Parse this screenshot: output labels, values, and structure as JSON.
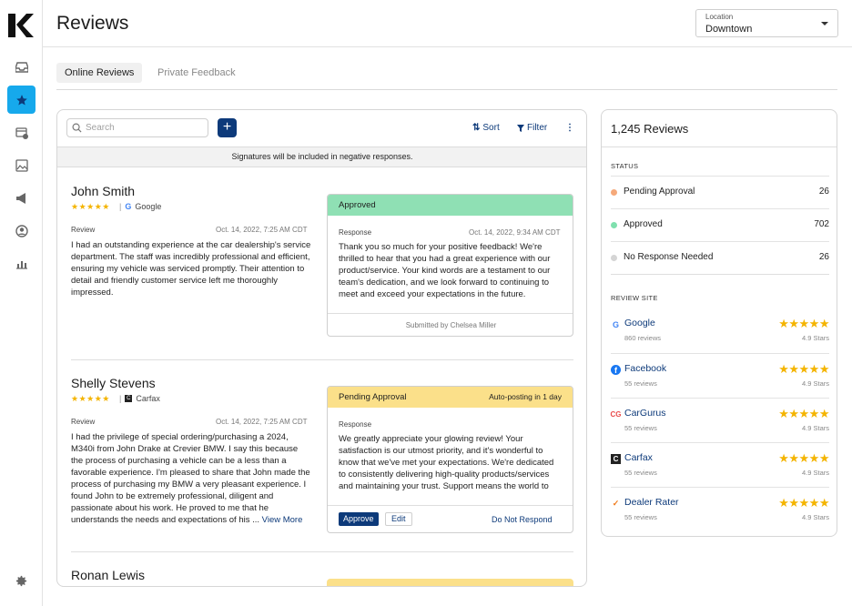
{
  "page": {
    "title": "Reviews"
  },
  "location": {
    "label": "Location",
    "value": "Downtown"
  },
  "tabs": [
    {
      "label": "Online Reviews"
    },
    {
      "label": "Private Feedback"
    }
  ],
  "toolbar": {
    "search_placeholder": "Search",
    "add_label": "+",
    "sort_label": "Sort",
    "filter_label": "Filter",
    "more_label": "⋮"
  },
  "banner": "Signatures will be included in negative responses.",
  "reviews": [
    {
      "name": "John Smith",
      "stars": "★★★★★",
      "site": "Google",
      "review_label": "Review",
      "date": "Oct. 14, 2022, 7:25 AM CDT",
      "text": "I had an outstanding experience at the car dealership's service department. The staff was incredibly professional and efficient, ensuring my vehicle was serviced promptly. Their attention to detail and friendly customer service left me thoroughly impressed.",
      "response": {
        "status": "Approved",
        "label": "Response",
        "date": "Oct. 14, 2022, 9:34 AM CDT",
        "text": "Thank you so much for your positive feedback! We're thrilled to hear that you had a great experience with our product/service. Your kind words are a testament to our team's dedication, and we look forward to continuing to meet and exceed your expectations in the future.",
        "footer": "Submitted by Chelsea Miller"
      }
    },
    {
      "name": "Shelly Stevens",
      "stars": "★★★★★",
      "site": "Carfax",
      "review_label": "Review",
      "date": "Oct. 14, 2022, 7:25 AM CDT",
      "text": "I had the privilege of special ordering/purchasing a 2024, M340i from John Drake at Crevier BMW. I say this because the process of purchasing a vehicle can be a less than a favorable experience. I'm pleased to share that John made the process of purchasing my BMW a very pleasant experience. I found John to be extremely professional, diligent and passionate about his work. He proved to me that he understands the needs and expectations of his ...",
      "view_more": "View More",
      "response": {
        "status": "Pending Approval",
        "autopost": "Auto-posting in 1 day",
        "label": "Response",
        "text": "We greatly appreciate your glowing review! Your satisfaction is our utmost priority, and it's wonderful to know that we've met your expectations. We're dedicated to consistently delivering high-quality products/services and maintaining your trust. Support means the world to",
        "approve_label": "Approve",
        "edit_label": "Edit",
        "dnr_label": "Do Not Respond"
      }
    },
    {
      "name": "Ronan Lewis"
    }
  ],
  "stats": {
    "title": "1,245 Reviews",
    "status_heading": "STATUS",
    "statuses": [
      {
        "label": "Pending Approval",
        "count": "26",
        "color": "#f5a97a"
      },
      {
        "label": "Approved",
        "count": "702",
        "color": "#7fe0ae"
      },
      {
        "label": "No Response Needed",
        "count": "26",
        "color": "#d5d5d5"
      }
    ],
    "site_heading": "REVIEW SITE",
    "sites": [
      {
        "name": "Google",
        "count": "860 reviews",
        "stars": "★★★★★",
        "rating": "4.9 Stars",
        "icon": "google-icon"
      },
      {
        "name": "Facebook",
        "count": "55 reviews",
        "stars": "★★★★★",
        "rating": "4.9 Stars",
        "icon": "facebook-icon"
      },
      {
        "name": "CarGurus",
        "count": "55 reviews",
        "stars": "★★★★★",
        "rating": "4.9 Stars",
        "icon": "cargurus-icon"
      },
      {
        "name": "Carfax",
        "count": "55 reviews",
        "stars": "★★★★★",
        "rating": "4.9 Stars",
        "icon": "carfax-icon"
      },
      {
        "name": "Dealer Rater",
        "count": "55 reviews",
        "stars": "★★★★★",
        "rating": "4.9 Stars",
        "icon": "dealerrater-icon"
      }
    ]
  },
  "colors": {
    "accent": "#0d3a7a",
    "sidebar_active": "#16a9ec",
    "star": "#f4b400"
  }
}
